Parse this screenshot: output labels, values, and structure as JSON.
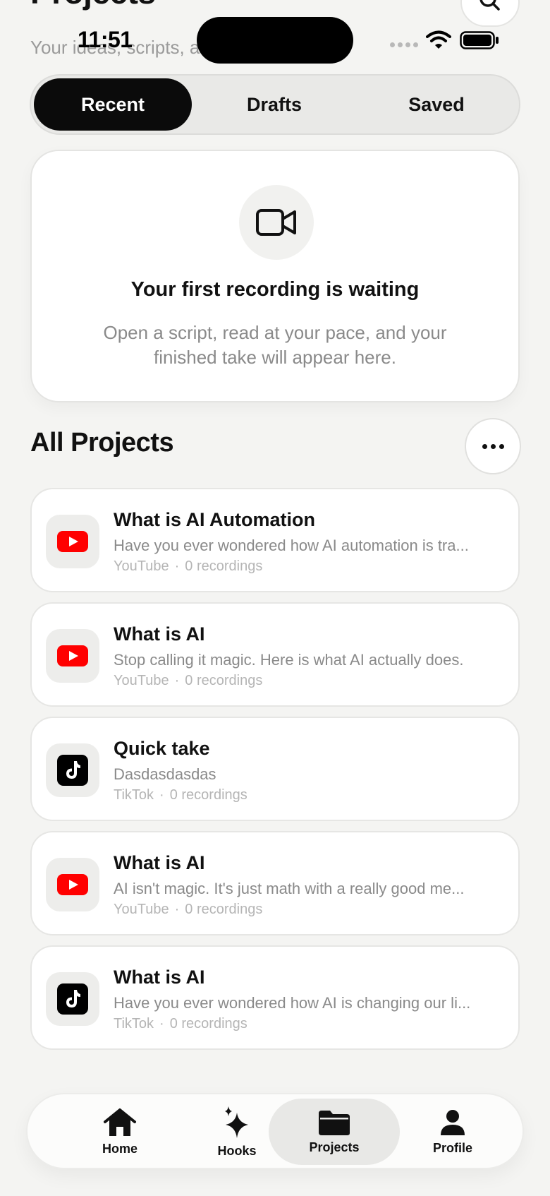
{
  "status_bar": {
    "time": "11:51"
  },
  "header": {
    "title": "Projects",
    "subtitle": "Your ideas, scripts, and takes"
  },
  "tabs": [
    {
      "label": "Recent",
      "active": true
    },
    {
      "label": "Drafts",
      "active": false
    },
    {
      "label": "Saved",
      "active": false
    }
  ],
  "empty_state": {
    "icon": "video-camera-icon",
    "title": "Your first recording is waiting",
    "description": "Open a script, read at your pace, and your finished take will appear here."
  },
  "section": {
    "title": "All Projects"
  },
  "projects": [
    {
      "title": "What is AI Automation",
      "description": "Have you ever wondered how AI automation is tra...",
      "platform": "YouTube",
      "recordings": "0 recordings",
      "icon": "youtube-icon"
    },
    {
      "title": "What is AI",
      "description": "Stop calling it magic. Here is what AI actually does.",
      "platform": "YouTube",
      "recordings": "0 recordings",
      "icon": "youtube-icon"
    },
    {
      "title": "Quick take",
      "description": "Dasdasdasdas",
      "platform": "TikTok",
      "recordings": "0 recordings",
      "icon": "tiktok-icon"
    },
    {
      "title": "What is AI",
      "description": "AI isn't magic. It's just math with a really good me...",
      "platform": "YouTube",
      "recordings": "0 recordings",
      "icon": "youtube-icon"
    },
    {
      "title": "What is AI",
      "description": "Have you ever wondered how AI is changing our li...",
      "platform": "TikTok",
      "recordings": "0 recordings",
      "icon": "tiktok-icon"
    }
  ],
  "meta_separator": "·",
  "nav": [
    {
      "label": "Home",
      "icon": "home-icon",
      "active": false
    },
    {
      "label": "Hooks",
      "icon": "sparkles-icon",
      "active": false
    },
    {
      "label": "Projects",
      "icon": "folder-icon",
      "active": true
    },
    {
      "label": "Profile",
      "icon": "person-icon",
      "active": false
    }
  ],
  "colors": {
    "accent": "#0b0b0b",
    "youtube": "#ff0000",
    "tiktok": "#000000",
    "background": "#f4f4f2"
  }
}
